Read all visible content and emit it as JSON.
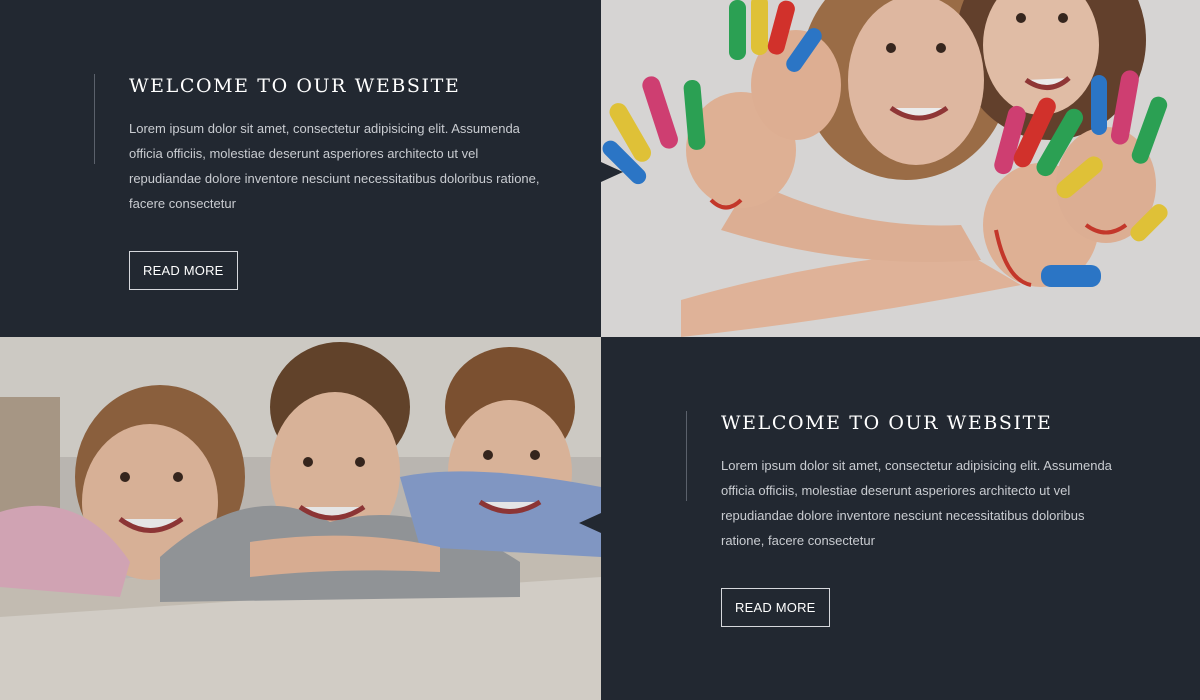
{
  "sections": [
    {
      "heading": "WELCOME TO OUR WEBSITE",
      "body": "Lorem ipsum dolor sit amet, consectetur adipisicing elit. Assumenda officia officiis, molestiae deserunt asperiores architecto ut vel repudiandae dolore inventore nesciunt necessitatibus doloribus ratione, facere consectetur",
      "button_label": "READ MORE"
    },
    {
      "heading": "WELCOME TO OUR WEBSITE",
      "body": "Lorem ipsum dolor sit amet, consectetur adipisicing elit. Assumenda officia officiis, molestiae deserunt asperiores architecto ut vel repudiandae dolore inventore nesciunt necessitatibus doloribus ratione, facere consectetur",
      "button_label": "READ MORE"
    }
  ],
  "colors": {
    "panel_bg": "#222831",
    "heading": "#ffffff",
    "body_text": "#c9ccd1",
    "button_border": "#d6d8dc"
  },
  "images": [
    {
      "name": "children-painted-hands-photo"
    },
    {
      "name": "three-kids-smiling-photo"
    }
  ]
}
